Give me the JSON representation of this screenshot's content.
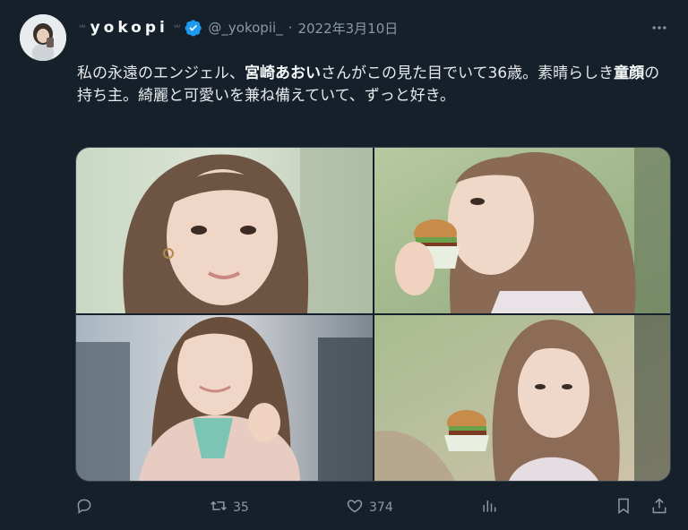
{
  "tweet": {
    "display_name": "yokopi",
    "deco_left": "ᐡᐡ",
    "deco_right": "ᐡᐡ",
    "handle": "@_yokopii_",
    "separator": "·",
    "date": "2022年3月10日",
    "text": {
      "p1": "私の永遠のエンジェル、",
      "b1": "宮崎あおい",
      "p2": "さんがこの見た目でいて36歳。素晴らしき",
      "b2": "童顔",
      "p3": "の持ち主。綺麗と可愛いを兼ね備えていて、ずっと好き。"
    }
  },
  "actions": {
    "replies": "",
    "retweets": "35",
    "likes": "374",
    "views": ""
  },
  "icons": {
    "verified": "verified-badge-icon",
    "more": "more-icon",
    "reply": "reply-icon",
    "retweet": "retweet-icon",
    "like": "heart-icon",
    "views": "views-icon",
    "bookmark": "bookmark-icon",
    "share": "share-icon"
  },
  "colors": {
    "background": "#15202b",
    "text": "#e7e9ea",
    "secondary": "#8b98a5",
    "verified": "#1d9bf0"
  }
}
